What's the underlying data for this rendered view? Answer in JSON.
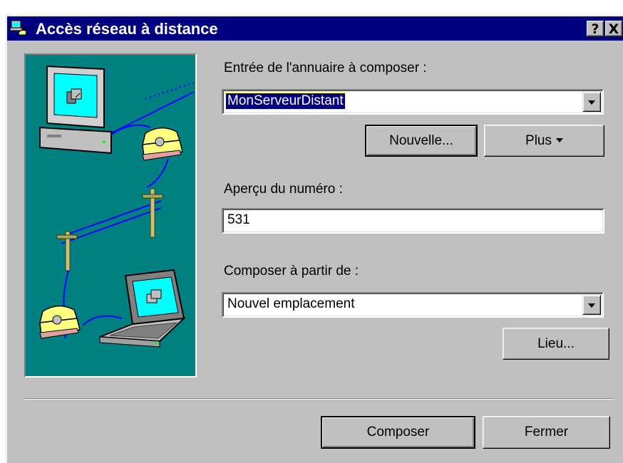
{
  "window": {
    "title": "Accès réseau à distance",
    "help_button": "?",
    "close_button": "X",
    "title_icon": "dial-up-networking-icon"
  },
  "illustration": {
    "icon": "dial-up-networking-illustration"
  },
  "phonebook": {
    "label": "Entrée de l'annuaire à composer :",
    "selected": "MonServeurDistant"
  },
  "buttons": {
    "new": "Nouvelle...",
    "more": "Plus",
    "location": "Lieu...",
    "dial": "Composer",
    "close": "Fermer"
  },
  "preview": {
    "label": "Aperçu du numéro :",
    "value": "531"
  },
  "dial_from": {
    "label": "Composer à partir de :",
    "selected": "Nouvel emplacement"
  },
  "colors": {
    "titlebar": "#000080",
    "dialog": "#c0c0c0",
    "illustration_bg": "#008080"
  }
}
